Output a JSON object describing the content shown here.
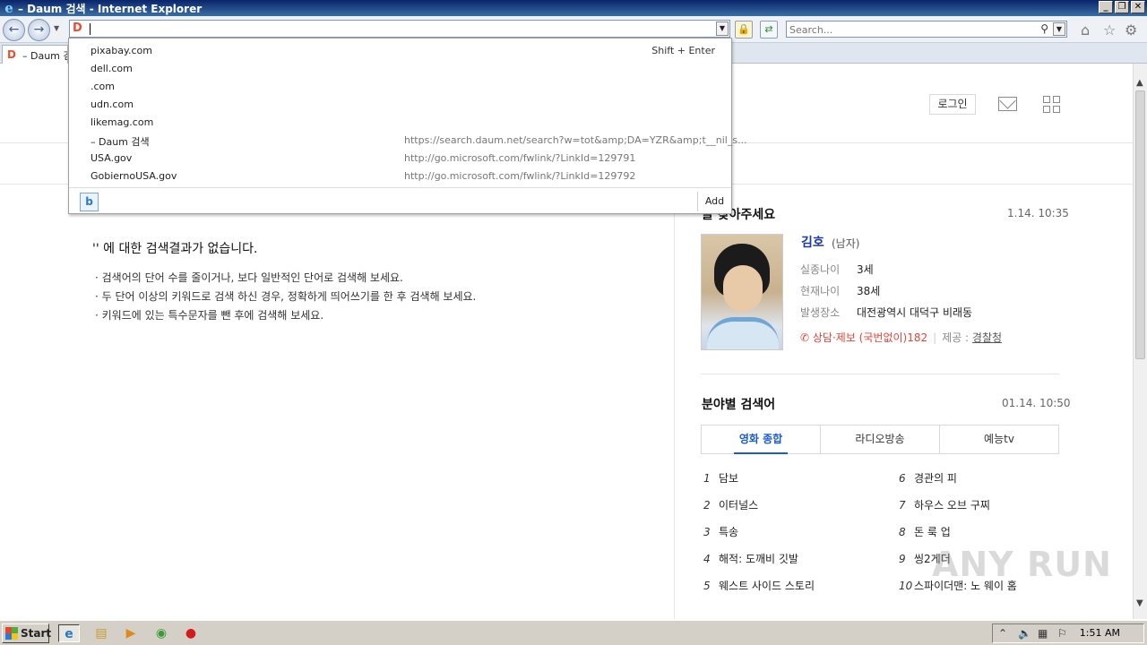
{
  "window": {
    "title": "– Daum 검색 - Internet Explorer"
  },
  "address": {
    "value": ""
  },
  "search": {
    "placeholder": "Search..."
  },
  "tab": {
    "title": "– Daum 검"
  },
  "dropdown": {
    "hint": "Shift + Enter",
    "items": [
      {
        "label": "pixabay.com",
        "url": ""
      },
      {
        "label": "dell.com",
        "url": ""
      },
      {
        "label": ".com",
        "url": ""
      },
      {
        "label": "udn.com",
        "url": ""
      },
      {
        "label": "likemag.com",
        "url": ""
      },
      {
        "label": "– Daum 검색",
        "url": "https://search.daum.net/search?w=tot&amp;DA=YZR&amp;t__nil_s..."
      },
      {
        "label": "USA.gov",
        "url": "http://go.microsoft.com/fwlink/?LinkId=129791"
      },
      {
        "label": "GobiernoUSA.gov",
        "url": "http://go.microsoft.com/fwlink/?LinkId=129792"
      }
    ],
    "add_label": "Add"
  },
  "header": {
    "login": "로그인"
  },
  "main": {
    "no_result": "'' 에 대한 검색결과가 없습니다.",
    "tips": [
      "· 검색어의 단어 수를 줄이거나, 보다 일반적인 단어로 검색해 보세요.",
      "· 두 단어 이상의 키워드로 검색 하신 경우, 정확하게 띄어쓰기를 한 후 검색해 보세요.",
      "· 키워드에 있는 특수문자를 뺀 후에 검색해 보세요."
    ]
  },
  "missing_child": {
    "title": "을 찾아주세요",
    "time": "1.14. 10:35",
    "name": "김호",
    "gender": "(남자)",
    "rows": [
      {
        "key": "실종나이",
        "value": "3세"
      },
      {
        "key": "현재나이",
        "value": "38세"
      },
      {
        "key": "발생장소",
        "value": "대전광역시 대덕구 비래동"
      }
    ],
    "report": "상담·제보 (국번없이)182",
    "provider_label": "제공 : ",
    "provider": "경찰청"
  },
  "trending": {
    "title": "분야별 검색어",
    "time": "01.14. 10:50",
    "tabs": [
      "영화 종합",
      "라디오방송",
      "예능tv"
    ],
    "left": [
      {
        "n": "1",
        "t": "담보"
      },
      {
        "n": "2",
        "t": "이터널스"
      },
      {
        "n": "3",
        "t": "특송"
      },
      {
        "n": "4",
        "t": "해적: 도깨비 깃발"
      },
      {
        "n": "5",
        "t": "웨스트 사이드 스토리"
      }
    ],
    "right": [
      {
        "n": "6",
        "t": "경관의 피"
      },
      {
        "n": "7",
        "t": "하우스 오브 구찌"
      },
      {
        "n": "8",
        "t": "돈 룩 업"
      },
      {
        "n": "9",
        "t": "씽2게더"
      },
      {
        "n": "10",
        "t": "스파이더맨: 노 웨이 홈"
      }
    ]
  },
  "taskbar": {
    "start": "Start",
    "clock": "1:51 AM"
  },
  "watermark": "ANY RUN"
}
